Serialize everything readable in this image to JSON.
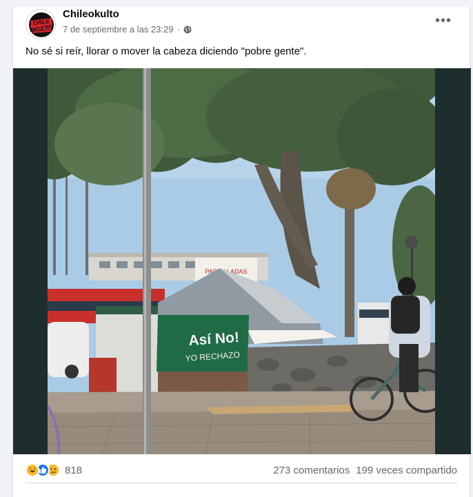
{
  "post": {
    "page_name": "Chileokulto",
    "timestamp": "7 de septiembre a las 23:29",
    "separator": "·",
    "privacy_icon": "globe-icon",
    "more_label": "•••",
    "text": "No sé si reír, llorar o mover la cabeza diciendo \"pobre gente\".",
    "avatar_logo_text": "CHILE OKULTO"
  },
  "photo": {
    "sign_left": "Así No!",
    "sign_right": "YO RECHAZO",
    "building_sign": "PARRILLADAS"
  },
  "footer": {
    "reaction_icons": [
      "haha-icon",
      "like-icon",
      "sad-icon"
    ],
    "reaction_count": "818",
    "comments": "273 comentarios",
    "shares": "199 veces compartido"
  },
  "colors": {
    "text_primary": "#050505",
    "text_secondary": "#65676b",
    "media_background": "#1d2e2d",
    "like_blue": "#1877f2",
    "reaction_yellow": "#f7b928"
  }
}
